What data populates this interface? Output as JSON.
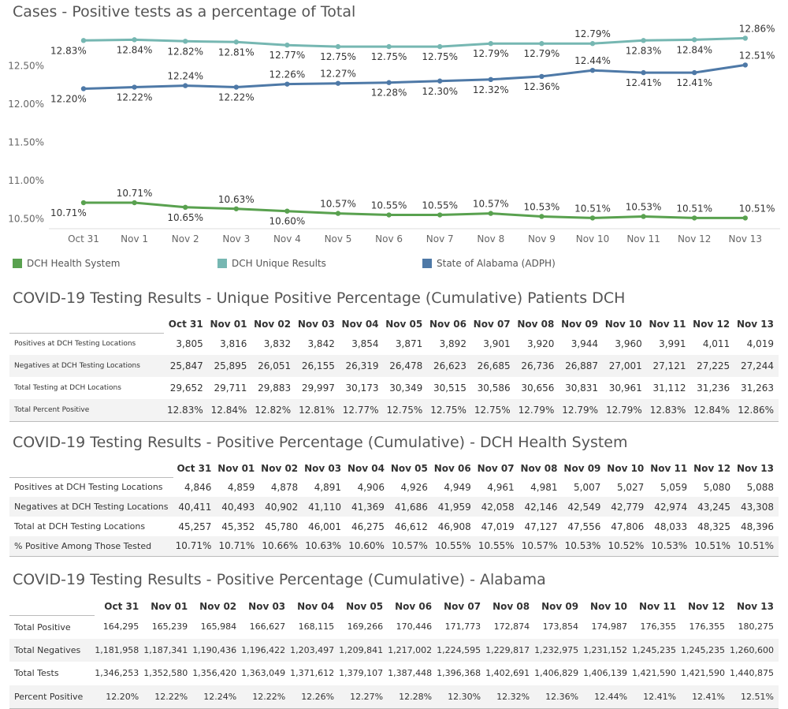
{
  "chart_data": {
    "type": "line",
    "title": "Cases - Positive tests as a percentage of Total",
    "categories": [
      "Oct 31",
      "Nov 1",
      "Nov 2",
      "Nov 3",
      "Nov 4",
      "Nov 5",
      "Nov 6",
      "Nov 7",
      "Nov 8",
      "Nov 9",
      "Nov 10",
      "Nov 11",
      "Nov 12",
      "Nov 13"
    ],
    "yticks": [
      "12.50%",
      "12.00%",
      "11.50%",
      "11.00%",
      "10.50%"
    ],
    "ytick_values": [
      12.5,
      12.0,
      11.5,
      11.0,
      10.5
    ],
    "ylim": [
      10.37,
      13.05
    ],
    "grid": false,
    "legend_position": "bottom",
    "series": [
      {
        "name": "DCH Health System",
        "color": "#59a14f",
        "values": [
          10.71,
          10.71,
          10.65,
          10.63,
          10.6,
          10.57,
          10.55,
          10.55,
          10.57,
          10.53,
          10.51,
          10.53,
          10.51,
          10.51
        ],
        "labels": [
          "10.71%",
          "10.71%",
          "10.65%",
          "10.63%",
          "10.60%",
          "10.57%",
          "10.55%",
          "10.55%",
          "10.57%",
          "10.53%",
          "10.51%",
          "10.53%",
          "10.51%",
          "10.51%"
        ],
        "label_pos": [
          "below",
          "above",
          "below",
          "above",
          "below",
          "above",
          "above",
          "above",
          "above",
          "above",
          "above",
          "above",
          "above",
          "above"
        ]
      },
      {
        "name": "DCH Unique Results",
        "color": "#76b7b2",
        "values": [
          12.83,
          12.84,
          12.82,
          12.81,
          12.77,
          12.75,
          12.75,
          12.75,
          12.79,
          12.79,
          12.79,
          12.83,
          12.84,
          12.86
        ],
        "labels": [
          "12.83%",
          "12.84%",
          "12.82%",
          "12.81%",
          "12.77%",
          "12.75%",
          "12.75%",
          "12.75%",
          "12.79%",
          "12.79%",
          "12.79%",
          "12.83%",
          "12.84%",
          "12.86%"
        ],
        "label_pos": [
          "below",
          "below",
          "below",
          "below",
          "below",
          "below",
          "below",
          "below",
          "below",
          "below",
          "above",
          "below",
          "below",
          "above"
        ]
      },
      {
        "name": "State of Alabama (ADPH)",
        "color": "#4e79a7",
        "values": [
          12.2,
          12.22,
          12.24,
          12.22,
          12.26,
          12.27,
          12.28,
          12.3,
          12.32,
          12.36,
          12.44,
          12.41,
          12.41,
          12.51
        ],
        "labels": [
          "12.20%",
          "12.22%",
          "12.24%",
          "12.22%",
          "12.26%",
          "12.27%",
          "12.28%",
          "12.30%",
          "12.32%",
          "12.36%",
          "12.44%",
          "12.41%",
          "12.41%",
          "12.51%"
        ],
        "label_pos": [
          "below",
          "below",
          "above",
          "below",
          "above",
          "above",
          "below",
          "below",
          "below",
          "below",
          "above",
          "below",
          "below",
          "above"
        ]
      }
    ]
  },
  "tables": [
    {
      "title": "COVID-19 Testing Results - Unique Positive Percentage (Cumulative) Patients DCH",
      "columns": [
        "Oct 31",
        "Nov 01",
        "Nov 02",
        "Nov 03",
        "Nov 04",
        "Nov 05",
        "Nov 06",
        "Nov 07",
        "Nov 08",
        "Nov 09",
        "Nov 10",
        "Nov 11",
        "Nov 12",
        "Nov 13"
      ],
      "rows": [
        {
          "label": "Positives at DCH Testing Locations",
          "cells": [
            "3,805",
            "3,816",
            "3,832",
            "3,842",
            "3,854",
            "3,871",
            "3,892",
            "3,901",
            "3,920",
            "3,944",
            "3,960",
            "3,991",
            "4,011",
            "4,019"
          ]
        },
        {
          "label": "Negatives at DCH Testing Locations",
          "cells": [
            "25,847",
            "25,895",
            "26,051",
            "26,155",
            "26,319",
            "26,478",
            "26,623",
            "26,685",
            "26,736",
            "26,887",
            "27,001",
            "27,121",
            "27,225",
            "27,244"
          ]
        },
        {
          "label": "Total Testing at DCH Locations",
          "cells": [
            "29,652",
            "29,711",
            "29,883",
            "29,997",
            "30,173",
            "30,349",
            "30,515",
            "30,586",
            "30,656",
            "30,831",
            "30,961",
            "31,112",
            "31,236",
            "31,263"
          ]
        },
        {
          "label": "Total Percent Positive",
          "cells": [
            "12.83%",
            "12.84%",
            "12.82%",
            "12.81%",
            "12.77%",
            "12.75%",
            "12.75%",
            "12.75%",
            "12.79%",
            "12.79%",
            "12.79%",
            "12.83%",
            "12.84%",
            "12.86%"
          ]
        }
      ]
    },
    {
      "title": "COVID-19 Testing Results - Positive Percentage (Cumulative) - DCH Health System",
      "columns": [
        "Oct 31",
        "Nov 01",
        "Nov 02",
        "Nov 03",
        "Nov 04",
        "Nov 05",
        "Nov 06",
        "Nov 07",
        "Nov 08",
        "Nov 09",
        "Nov 10",
        "Nov 11",
        "Nov 12",
        "Nov 13"
      ],
      "rows": [
        {
          "label": "Positives at DCH Testing Locations",
          "cells": [
            "4,846",
            "4,859",
            "4,878",
            "4,891",
            "4,906",
            "4,926",
            "4,949",
            "4,961",
            "4,981",
            "5,007",
            "5,027",
            "5,059",
            "5,080",
            "5,088"
          ]
        },
        {
          "label": "Negatives at DCH Testing Locations",
          "cells": [
            "40,411",
            "40,493",
            "40,902",
            "41,110",
            "41,369",
            "41,686",
            "41,959",
            "42,058",
            "42,146",
            "42,549",
            "42,779",
            "42,974",
            "43,245",
            "43,308"
          ]
        },
        {
          "label": "Total at DCH Testing Locations",
          "cells": [
            "45,257",
            "45,352",
            "45,780",
            "46,001",
            "46,275",
            "46,612",
            "46,908",
            "47,019",
            "47,127",
            "47,556",
            "47,806",
            "48,033",
            "48,325",
            "48,396"
          ]
        },
        {
          "label": "% Positive Among Those Tested",
          "cells": [
            "10.71%",
            "10.71%",
            "10.66%",
            "10.63%",
            "10.60%",
            "10.57%",
            "10.55%",
            "10.55%",
            "10.57%",
            "10.53%",
            "10.52%",
            "10.53%",
            "10.51%",
            "10.51%"
          ]
        }
      ]
    },
    {
      "title": "COVID-19 Testing Results - Positive Percentage (Cumulative) - Alabama",
      "columns": [
        "Oct 31",
        "Nov 01",
        "Nov 02",
        "Nov 03",
        "Nov 04",
        "Nov 05",
        "Nov 06",
        "Nov 07",
        "Nov 08",
        "Nov 09",
        "Nov 10",
        "Nov 11",
        "Nov 12",
        "Nov 13"
      ],
      "rows": [
        {
          "label": "Total Positive",
          "cells": [
            "164,295",
            "165,239",
            "165,984",
            "166,627",
            "168,115",
            "169,266",
            "170,446",
            "171,773",
            "172,874",
            "173,854",
            "174,987",
            "176,355",
            "176,355",
            "180,275"
          ]
        },
        {
          "label": "Total Negatives",
          "cells": [
            "1,181,958",
            "1,187,341",
            "1,190,436",
            "1,196,422",
            "1,203,497",
            "1,209,841",
            "1,217,002",
            "1,224,595",
            "1,229,817",
            "1,232,975",
            "1,231,152",
            "1,245,235",
            "1,245,235",
            "1,260,600"
          ]
        },
        {
          "label": "Total Tests",
          "cells": [
            "1,346,253",
            "1,352,580",
            "1,356,420",
            "1,363,049",
            "1,371,612",
            "1,379,107",
            "1,387,448",
            "1,396,368",
            "1,402,691",
            "1,406,829",
            "1,406,139",
            "1,421,590",
            "1,421,590",
            "1,440,875"
          ]
        },
        {
          "label": "Percent Positive",
          "cells": [
            "12.20%",
            "12.22%",
            "12.24%",
            "12.22%",
            "12.26%",
            "12.27%",
            "12.28%",
            "12.30%",
            "12.32%",
            "12.36%",
            "12.44%",
            "12.41%",
            "12.41%",
            "12.51%"
          ]
        }
      ]
    }
  ]
}
